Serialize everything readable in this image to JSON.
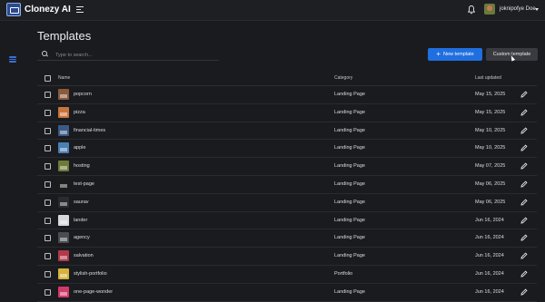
{
  "app": {
    "brand": "Clonezy AI",
    "user": "joknipofye Doe",
    "colors": {
      "accent": "#1f6fe0",
      "background": "#1a1b1f",
      "surface": "#1e1f23"
    }
  },
  "page": {
    "title": "Templates",
    "search_placeholder": "Type to search...",
    "new_template_label": "New template",
    "custom_template_label": "Custom template"
  },
  "table": {
    "columns": {
      "name": "Name",
      "category": "Category",
      "updated": "Last updated"
    },
    "rows": [
      {
        "name": "popcorn",
        "category": "Landing Page",
        "updated": "May 15, 2025",
        "thumb_color": "#8a5a3c"
      },
      {
        "name": "pizza",
        "category": "Landing Page",
        "updated": "May 15, 2025",
        "thumb_color": "#c8743a"
      },
      {
        "name": "financial-times",
        "category": "Landing Page",
        "updated": "May 10, 2025",
        "thumb_color": "#3c5a86"
      },
      {
        "name": "apple",
        "category": "Landing Page",
        "updated": "May 10, 2025",
        "thumb_color": "#4a7fb2"
      },
      {
        "name": "hosting",
        "category": "Landing Page",
        "updated": "May 07, 2025",
        "thumb_color": "#6d7b3a"
      },
      {
        "name": "test-page",
        "category": "Landing Page",
        "updated": "May 06, 2025",
        "thumb_color": "#1c1c1c"
      },
      {
        "name": "saurav",
        "category": "Landing Page",
        "updated": "May 06, 2025",
        "thumb_color": "#2b2b2f"
      },
      {
        "name": "lander",
        "category": "Landing Page",
        "updated": "Jun 16, 2024",
        "thumb_color": "#d8d8dc"
      },
      {
        "name": "agency",
        "category": "Landing Page",
        "updated": "Jun 16, 2024",
        "thumb_color": "#4b4b52"
      },
      {
        "name": "salvation",
        "category": "Landing Page",
        "updated": "Jun 16, 2024",
        "thumb_color": "#b03a4a"
      },
      {
        "name": "stylish-portfolio",
        "category": "Portfolio",
        "updated": "Jun 16, 2024",
        "thumb_color": "#d6b23a"
      },
      {
        "name": "one-page-wonder",
        "category": "Landing Page",
        "updated": "Jun 16, 2024",
        "thumb_color": "#d03a6a"
      }
    ]
  },
  "icons": {
    "menu": "menu-toggle-icon",
    "bell": "bell-icon",
    "search": "search-icon",
    "plus": "plus-icon",
    "edit": "pencil-icon",
    "templates_nav": "templates-nav-icon"
  }
}
